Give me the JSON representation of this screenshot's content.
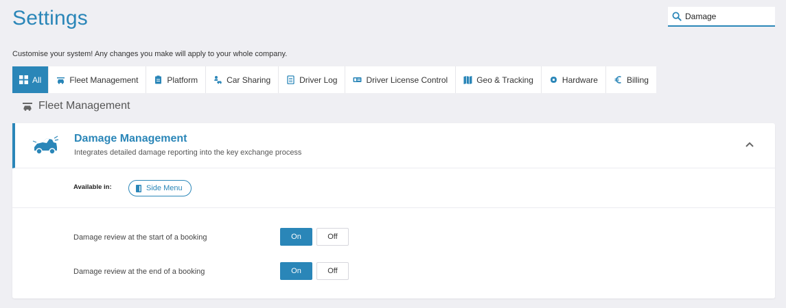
{
  "header": {
    "title": "Settings",
    "search_value": "Damage",
    "subtitle": "Customise your system! Any changes you make will apply to your whole company."
  },
  "tabs": [
    {
      "label": "All",
      "icon": "grid-icon",
      "active": true
    },
    {
      "label": "Fleet Management",
      "icon": "car-wash-icon",
      "active": false
    },
    {
      "label": "Platform",
      "icon": "clipboard-icon",
      "active": false
    },
    {
      "label": "Car Sharing",
      "icon": "car-sharing-icon",
      "active": false
    },
    {
      "label": "Driver Log",
      "icon": "notebook-icon",
      "active": false
    },
    {
      "label": "Driver License Control",
      "icon": "id-card-icon",
      "active": false
    },
    {
      "label": "Geo & Tracking",
      "icon": "map-icon",
      "active": false
    },
    {
      "label": "Hardware",
      "icon": "chip-icon",
      "active": false
    },
    {
      "label": "Billing",
      "icon": "euro-icon",
      "active": false
    }
  ],
  "section": {
    "heading": "Fleet Management",
    "icon": "car-wash-icon"
  },
  "card": {
    "title": "Damage Management",
    "description": "Integrates detailed damage reporting into the key exchange process",
    "icon": "damaged-car-icon",
    "available_label": "Available in:",
    "available_chip": "Side Menu",
    "settings": [
      {
        "label": "Damage review at the start of a booking",
        "on_label": "On",
        "off_label": "Off",
        "value": "On"
      },
      {
        "label": "Damage review at the end of a booking",
        "on_label": "On",
        "off_label": "Off",
        "value": "On"
      }
    ]
  },
  "colors": {
    "accent": "#2a86b8",
    "background": "#efeff3"
  }
}
